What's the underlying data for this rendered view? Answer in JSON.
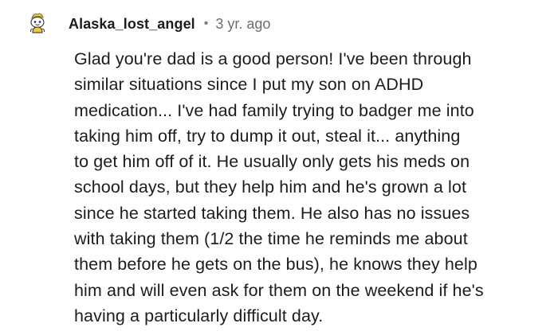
{
  "comment": {
    "author": "Alaska_lost_angel",
    "separator": "•",
    "age": "3 yr. ago",
    "avatar_icon": "snoo-avatar-icon",
    "body_lines": [
      "Glad you're dad is a good person! I've been through",
      "similar situations since I put my son on ADHD",
      "medication... I've had family trying to badger me into",
      "taking him off, try to dump it out, steal it... anything",
      "to get him off of it. He usually only gets his meds on",
      "school days, but they help him and he's grown a lot",
      "since he started taking them. He also has no issues",
      "with taking them (1/2 the time he reminds me about",
      "them before he gets on the bus), he knows they help",
      "him and will even ask for them on the weekend if he's",
      "having a particularly difficult day."
    ]
  },
  "colors": {
    "text": "#1c1c1c",
    "meta": "#6e6e6e",
    "avatar_fill": "#f5d54a"
  }
}
